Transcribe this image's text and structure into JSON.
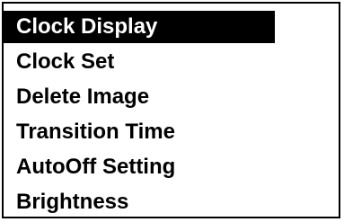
{
  "menu": {
    "selected_index": 0,
    "items": [
      {
        "label": "Clock Display"
      },
      {
        "label": "Clock Set"
      },
      {
        "label": "Delete Image"
      },
      {
        "label": "Transition Time"
      },
      {
        "label": "AutoOff Setting"
      },
      {
        "label": "Brightness"
      }
    ]
  },
  "colors": {
    "background": "#ffffff",
    "foreground": "#000000",
    "selected_background": "#000000",
    "selected_foreground": "#ffffff"
  }
}
